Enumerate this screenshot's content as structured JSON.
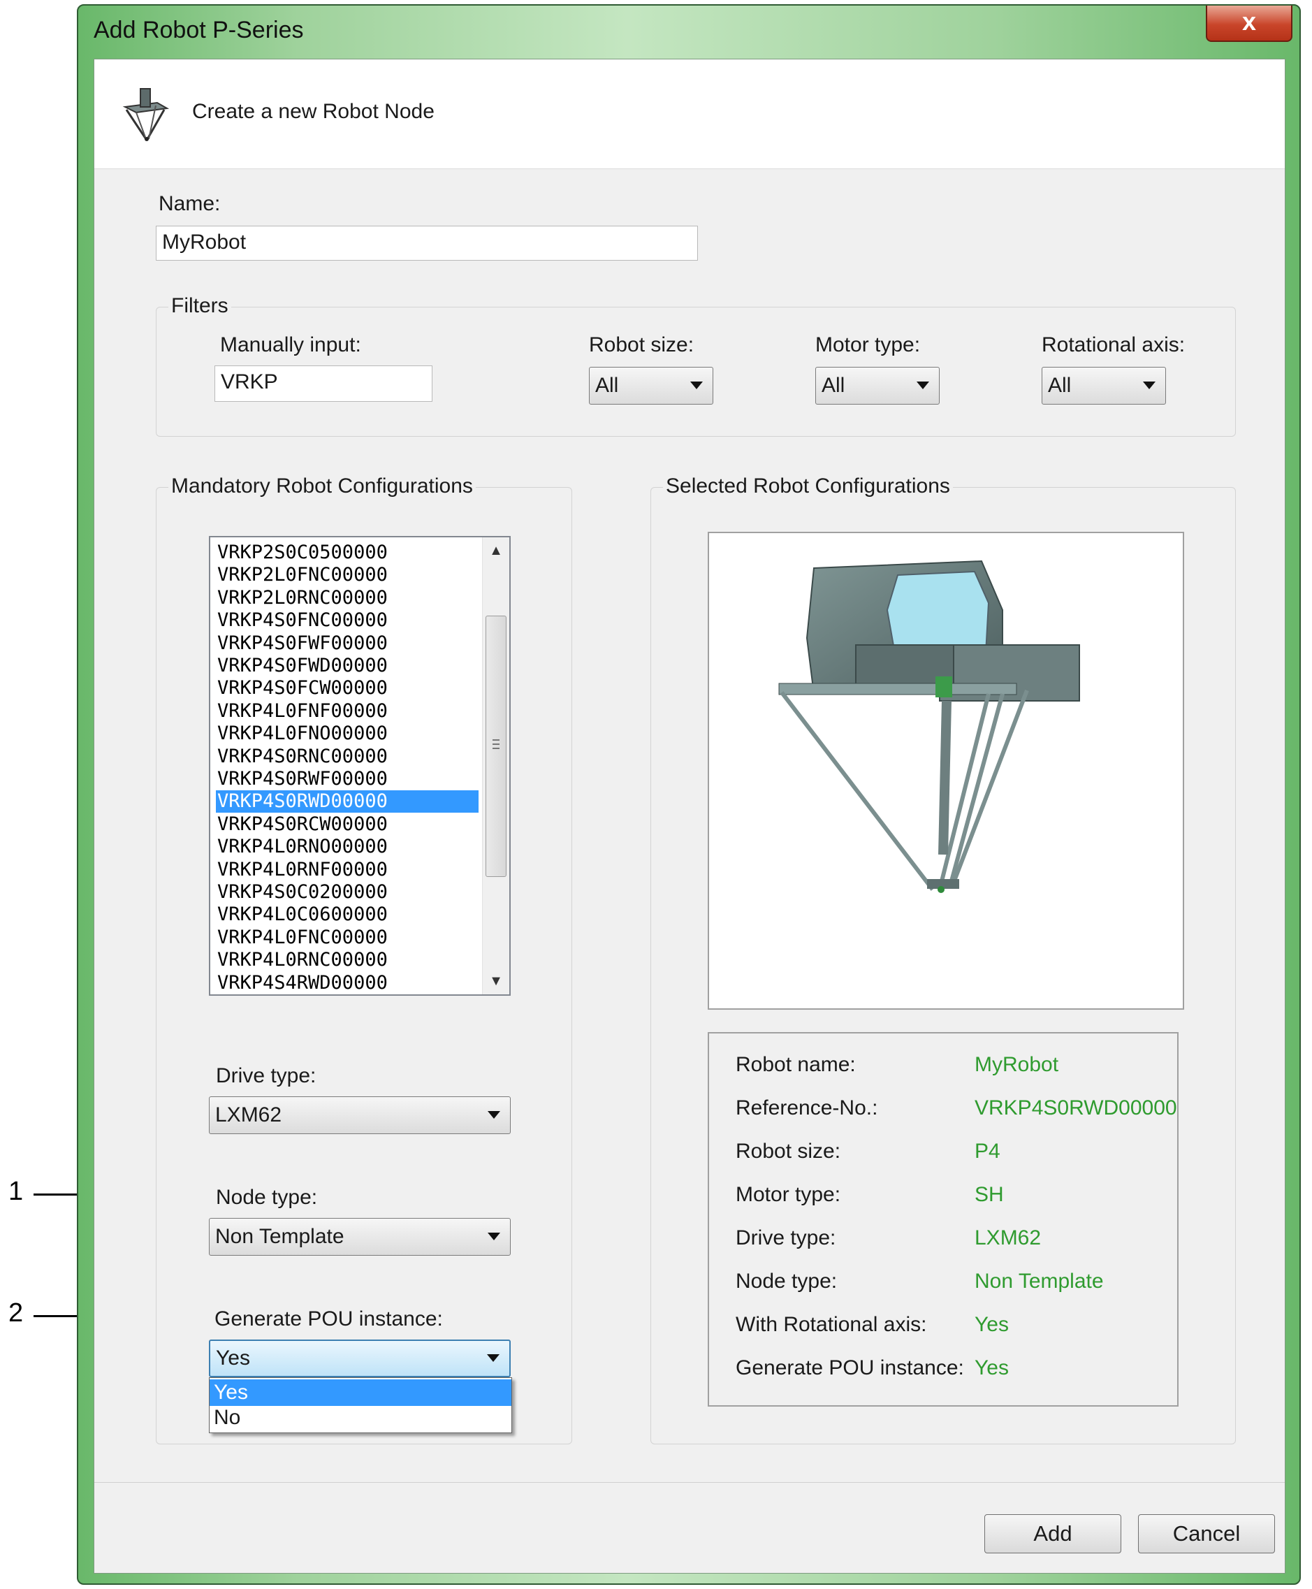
{
  "window": {
    "title": "Add Robot P-Series",
    "close_glyph": "x"
  },
  "header": {
    "text": "Create a new Robot Node",
    "icon": "delta-robot-icon"
  },
  "name_field": {
    "label": "Name:",
    "value": "MyRobot"
  },
  "filters": {
    "title": "Filters",
    "manual_label": "Manually input:",
    "manual_value": "VRKP",
    "robot_size_label": "Robot size:",
    "robot_size_value": "All",
    "motor_type_label": "Motor type:",
    "motor_type_value": "All",
    "rotational_axis_label": "Rotational axis:",
    "rotational_axis_value": "All"
  },
  "mandatory": {
    "title": "Mandatory Robot Configurations",
    "items": [
      "VRKP2S0C0500000",
      "VRKP2L0FNC00000",
      "VRKP2L0RNC00000",
      "VRKP4S0FNC00000",
      "VRKP4S0FWF00000",
      "VRKP4S0FWD00000",
      "VRKP4S0FCW00000",
      "VRKP4L0FNF00000",
      "VRKP4L0FNO00000",
      "VRKP4S0RNC00000",
      "VRKP4S0RWF00000",
      "VRKP4S0RWD00000",
      "VRKP4S0RCW00000",
      "VRKP4L0RNO00000",
      "VRKP4L0RNF00000",
      "VRKP4S0C0200000",
      "VRKP4L0C0600000",
      "VRKP4L0FNC00000",
      "VRKP4L0RNC00000",
      "VRKP4S4RWD00000"
    ],
    "selected_index": 11,
    "drive_type_label": "Drive type:",
    "drive_type_value": "LXM62",
    "node_type_label": "Node type:",
    "node_type_value": "Non Template",
    "generate_pou_label": "Generate POU instance:",
    "generate_pou_value": "Yes",
    "generate_pou_options": [
      "Yes",
      "No"
    ]
  },
  "selected": {
    "title": "Selected Robot Configurations",
    "rows": [
      {
        "label": "Robot name:",
        "value": "MyRobot"
      },
      {
        "label": "Reference-No.:",
        "value": "VRKP4S0RWD00000"
      },
      {
        "label": "Robot size:",
        "value": "P4"
      },
      {
        "label": "Motor type:",
        "value": "SH"
      },
      {
        "label": "Drive type:",
        "value": "LXM62"
      },
      {
        "label": "Node type:",
        "value": "Non Template"
      },
      {
        "label": "With Rotational axis:",
        "value": "Yes"
      },
      {
        "label": "Generate POU instance:",
        "value": "Yes"
      }
    ]
  },
  "buttons": {
    "add": "Add",
    "cancel": "Cancel"
  },
  "callouts": {
    "one": "1",
    "two": "2"
  },
  "colors": {
    "value_green": "#2f9b2f",
    "selection_blue": "#3399ff",
    "title_green": "#9fd29c"
  }
}
